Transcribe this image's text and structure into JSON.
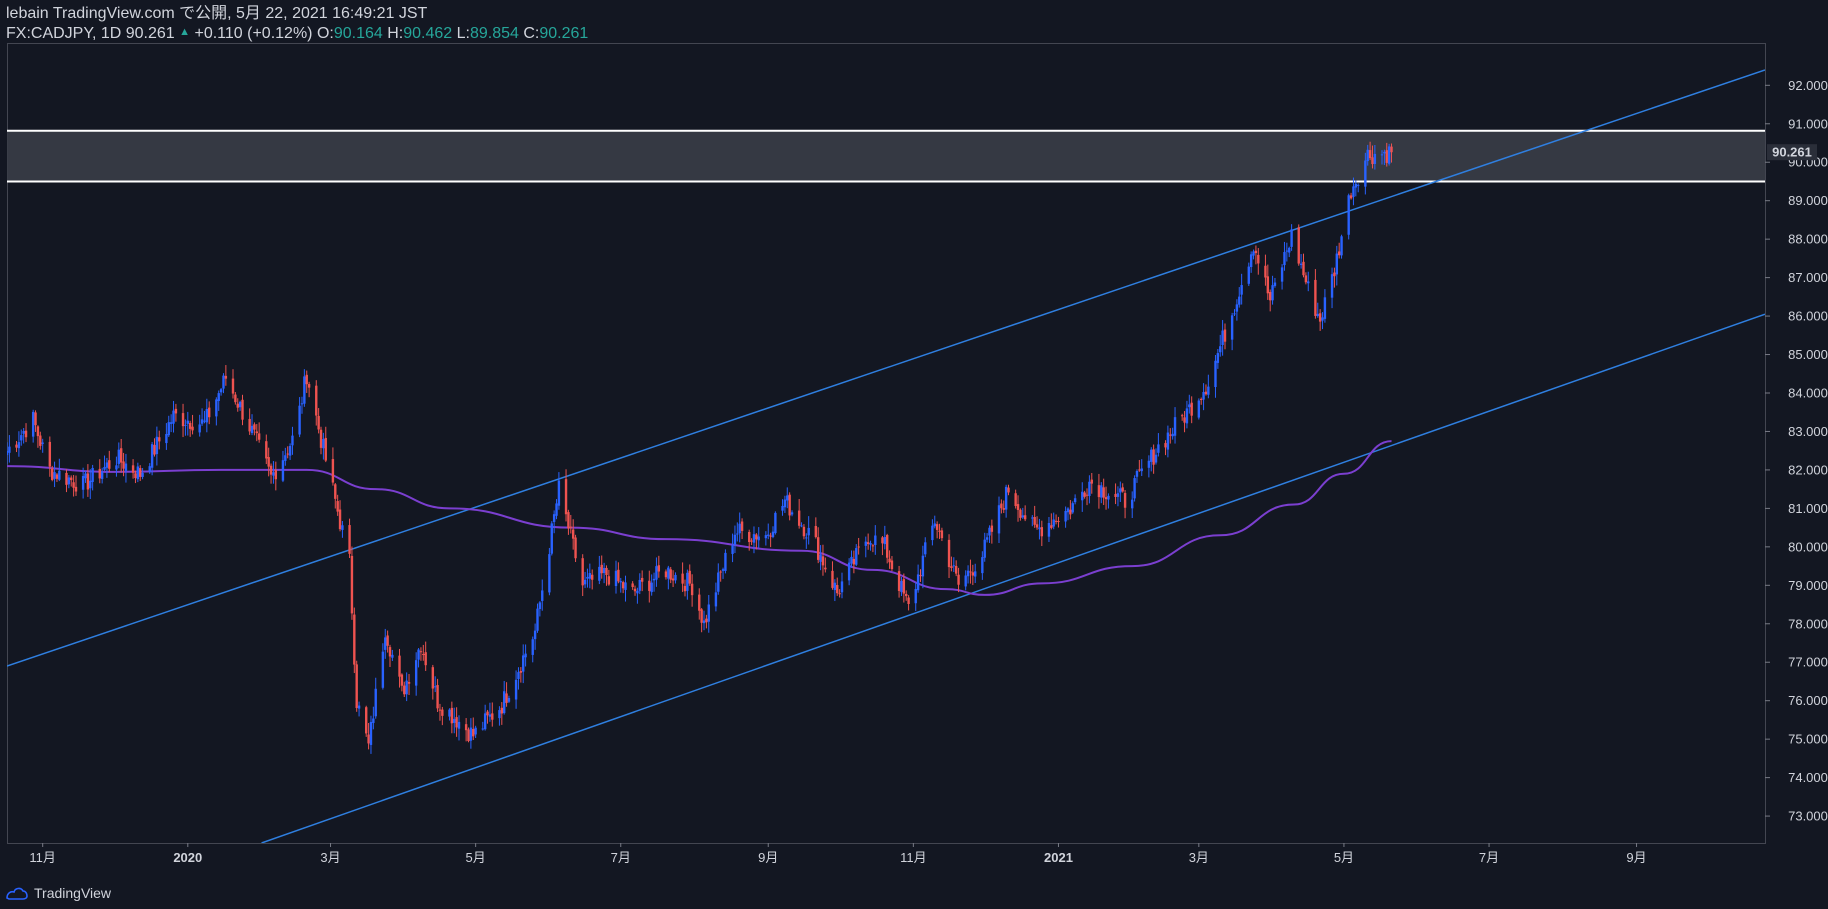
{
  "header": {
    "line1": "lebain TradingView.com で公開, 5月 22, 2021 16:49:21 JST",
    "symbol": "FX:CADJPY, 1D",
    "last": "90.261",
    "change": "+0.110 (+0.12%)",
    "o_label": "O:",
    "o_val": "90.164",
    "h_label": "H:",
    "h_val": "90.462",
    "l_label": "L:",
    "l_val": "89.854",
    "c_label": "C:",
    "c_val": "90.261"
  },
  "footer": {
    "brand": "TradingView"
  },
  "colors": {
    "background": "#131722",
    "up": "#2962ff",
    "down": "#ef5350",
    "ma": "#7b3fd0",
    "channel": "#2f7fe0",
    "zone_fill": "#3a3d47",
    "zone_border": "#ffffff"
  },
  "chart_data": {
    "type": "candlestick",
    "symbol": "FX:CADJPY",
    "interval": "1D",
    "y_ticks": [
      "92.000",
      "91.000",
      "90.000",
      "89.000",
      "88.000",
      "87.000",
      "86.000",
      "85.000",
      "84.000",
      "83.000",
      "82.000",
      "81.000",
      "80.000",
      "79.000",
      "78.000",
      "77.000",
      "76.000",
      "75.000",
      "74.000",
      "73.000"
    ],
    "y_range": [
      72.3,
      93.1
    ],
    "last_price_label": "90.261",
    "x_ticks": [
      {
        "label": "11月",
        "date": "2019-11-01"
      },
      {
        "label": "2020",
        "date": "2020-01-01"
      },
      {
        "label": "3月",
        "date": "2020-03-01"
      },
      {
        "label": "5月",
        "date": "2020-05-01"
      },
      {
        "label": "7月",
        "date": "2020-07-01"
      },
      {
        "label": "9月",
        "date": "2020-09-01"
      },
      {
        "label": "11月",
        "date": "2020-11-01"
      },
      {
        "label": "2021",
        "date": "2021-01-01"
      },
      {
        "label": "3月",
        "date": "2021-03-01"
      },
      {
        "label": "5月",
        "date": "2021-05-01"
      },
      {
        "label": "7月",
        "date": "2021-07-01"
      },
      {
        "label": "9月",
        "date": "2021-09-01"
      }
    ],
    "x_range": [
      "2019-10-17",
      "2021-10-25"
    ],
    "zone": {
      "low": 89.5,
      "high": 90.82
    },
    "channel_upper": [
      [
        "2019-10-17",
        76.9
      ],
      [
        "2021-10-25",
        92.4
      ]
    ],
    "channel_lower": [
      [
        "2020-02-01",
        72.3
      ],
      [
        "2021-10-25",
        86.05
      ]
    ],
    "moving_average": [
      [
        "2019-10-17",
        82.1
      ],
      [
        "2019-12-01",
        81.95
      ],
      [
        "2020-01-15",
        82.0
      ],
      [
        "2020-02-20",
        82.0
      ],
      [
        "2020-03-20",
        81.5
      ],
      [
        "2020-04-20",
        81.0
      ],
      [
        "2020-06-10",
        80.5
      ],
      [
        "2020-07-20",
        80.2
      ],
      [
        "2020-09-15",
        79.9
      ],
      [
        "2020-10-15",
        79.4
      ],
      [
        "2020-11-15",
        78.9
      ],
      [
        "2020-12-01",
        78.75
      ],
      [
        "2020-12-25",
        79.05
      ],
      [
        "2021-02-01",
        79.5
      ],
      [
        "2021-03-10",
        80.3
      ],
      [
        "2021-04-10",
        81.1
      ],
      [
        "2021-05-01",
        81.9
      ],
      [
        "2021-05-21",
        82.75
      ]
    ],
    "keypoints": [
      [
        "2019-10-17",
        82.5
      ],
      [
        "2019-10-28",
        83.3
      ],
      [
        "2019-11-04",
        82.0
      ],
      [
        "2019-11-18",
        81.6
      ],
      [
        "2019-12-02",
        82.3
      ],
      [
        "2019-12-12",
        81.9
      ],
      [
        "2019-12-26",
        83.4
      ],
      [
        "2020-01-08",
        83.2
      ],
      [
        "2020-01-17",
        84.4
      ],
      [
        "2020-01-28",
        83.0
      ],
      [
        "2020-02-05",
        81.8
      ],
      [
        "2020-02-15",
        82.9
      ],
      [
        "2020-02-20",
        84.5
      ],
      [
        "2020-02-26",
        82.8
      ],
      [
        "2020-03-09",
        79.6
      ],
      [
        "2020-03-12",
        76.0
      ],
      [
        "2020-03-17",
        74.8
      ],
      [
        "2020-03-24",
        77.9
      ],
      [
        "2020-03-31",
        76.2
      ],
      [
        "2020-04-08",
        77.5
      ],
      [
        "2020-04-15",
        76.0
      ],
      [
        "2020-04-30",
        75.1
      ],
      [
        "2020-05-12",
        75.9
      ],
      [
        "2020-05-26",
        77.8
      ],
      [
        "2020-06-05",
        81.5
      ],
      [
        "2020-06-15",
        79.0
      ],
      [
        "2020-06-25",
        79.3
      ],
      [
        "2020-07-06",
        78.8
      ],
      [
        "2020-07-20",
        79.4
      ],
      [
        "2020-07-31",
        79.0
      ],
      [
        "2020-08-05",
        78.0
      ],
      [
        "2020-08-18",
        80.4
      ],
      [
        "2020-08-31",
        80.3
      ],
      [
        "2020-09-08",
        81.2
      ],
      [
        "2020-09-20",
        80.2
      ],
      [
        "2020-09-30",
        78.8
      ],
      [
        "2020-10-13",
        80.3
      ],
      [
        "2020-10-20",
        80.0
      ],
      [
        "2020-10-30",
        78.4
      ],
      [
        "2020-11-10",
        80.7
      ],
      [
        "2020-11-20",
        79.0
      ],
      [
        "2020-11-30",
        79.8
      ],
      [
        "2020-12-11",
        81.5
      ],
      [
        "2020-12-22",
        80.4
      ],
      [
        "2021-01-06",
        81.0
      ],
      [
        "2021-01-14",
        81.7
      ],
      [
        "2021-01-29",
        81.2
      ],
      [
        "2021-02-12",
        82.6
      ],
      [
        "2021-02-24",
        83.5
      ],
      [
        "2021-03-05",
        84.3
      ],
      [
        "2021-03-15",
        86.1
      ],
      [
        "2021-03-24",
        87.9
      ],
      [
        "2021-03-31",
        86.4
      ],
      [
        "2021-04-09",
        88.1
      ],
      [
        "2021-04-16",
        86.7
      ],
      [
        "2021-04-21",
        85.9
      ],
      [
        "2021-04-27",
        87.2
      ],
      [
        "2021-05-04",
        89.3
      ],
      [
        "2021-05-11",
        90.2
      ],
      [
        "2021-05-21",
        90.26
      ]
    ]
  }
}
